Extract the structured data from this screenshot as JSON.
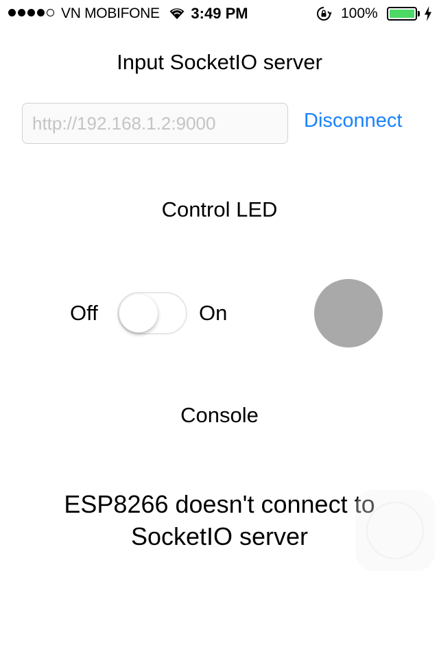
{
  "status_bar": {
    "carrier": "VN MOBIFONE",
    "time": "3:49 PM",
    "battery_percent": "100%",
    "signal_bars_filled": 4,
    "signal_bars_total": 5,
    "icons": [
      "wifi-icon",
      "rotation-lock-icon",
      "battery-icon",
      "charging-icon"
    ],
    "battery_color": "#4cd964"
  },
  "server": {
    "title": "Input SocketIO server",
    "input_value": "",
    "input_placeholder": "http://192.168.1.2:9000",
    "disconnect_label": "Disconnect",
    "accent_color": "#1a82fb"
  },
  "led": {
    "title": "Control LED",
    "off_label": "Off",
    "on_label": "On",
    "switch_on": false,
    "indicator_color": "#a9a9a9"
  },
  "console": {
    "title": "Console",
    "message": "ESP8266 doesn't connect to SocketIO server"
  }
}
